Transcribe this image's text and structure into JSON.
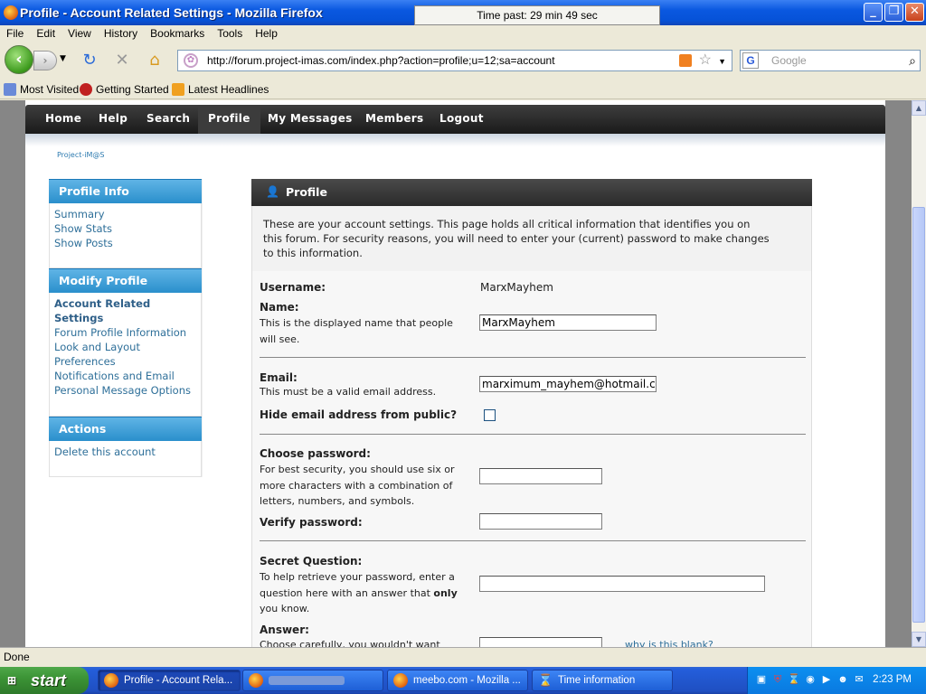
{
  "window": {
    "title": "Profile - Account Related Settings - Mozilla Firefox",
    "timer_text": "Time past: 29 min 49 sec",
    "minimize": "_",
    "restore": "❐",
    "close": "✕"
  },
  "menu": [
    "File",
    "Edit",
    "View",
    "History",
    "Bookmarks",
    "Tools",
    "Help"
  ],
  "navbar": {
    "url": "http://forum.project-imas.com/index.php?action=profile;u=12;sa=account",
    "search_placeholder": "Google",
    "search_engine_letter": "G"
  },
  "bookmarks": [
    "Most Visited",
    "Getting Started",
    "Latest Headlines"
  ],
  "site_nav": {
    "items": [
      "Home",
      "Help",
      "Search",
      "Profile",
      "My Messages",
      "Members",
      "Logout"
    ],
    "active": "Profile"
  },
  "brand": "Project-iM@S",
  "sidebar": {
    "profile_info": {
      "title": "Profile Info",
      "links": [
        "Summary",
        "Show Stats",
        "Show Posts"
      ]
    },
    "modify_profile": {
      "title": "Modify Profile",
      "active_line1": "Account Related",
      "active_line2": "Settings",
      "links": [
        "Forum Profile Information",
        "Look and Layout",
        "Preferences",
        "Notifications and Email",
        "Personal Message Options"
      ]
    },
    "actions": {
      "title": "Actions",
      "links": [
        "Delete this account"
      ]
    }
  },
  "profile": {
    "header": "Profile",
    "intro": "These are your account settings. This page holds all critical information that identifies you on this forum. For security reasons, you will need to enter your (current) password to make changes to this information.",
    "username_label": "Username:",
    "username_value": "MarxMayhem",
    "name_label": "Name:",
    "name_desc": "This is the displayed name that people will see.",
    "name_value": "MarxMayhem",
    "email_label": "Email:",
    "email_desc": "This must be a valid email address.",
    "email_value": "marximum_mayhem@hotmail.c",
    "hide_email_label": "Hide email address from public?",
    "hide_email_checked": false,
    "choose_password_label": "Choose password:",
    "choose_password_desc": "For best security, you should use six or more characters with a combination of letters, numbers, and symbols.",
    "verify_password_label": "Verify password:",
    "secret_question_label": "Secret Question:",
    "secret_question_desc_a": "To help retrieve your password, enter a question here with an answer that ",
    "secret_question_desc_bold": "only",
    "secret_question_desc_b": "you know.",
    "answer_label": "Answer:",
    "answer_desc": "Choose carefully, you wouldn't want",
    "why_blank_link": "why is this blank?"
  },
  "status": "Done",
  "taskbar": {
    "start": "start",
    "tasks": [
      "Profile - Account Rela...",
      "",
      "meebo.com - Mozilla ...",
      "Time information"
    ],
    "clock": "2:23 PM"
  },
  "colors": {
    "accent_blue": "#2a8fcc",
    "link": "#2e6f99",
    "nav_dark": "#2a2a2a"
  }
}
